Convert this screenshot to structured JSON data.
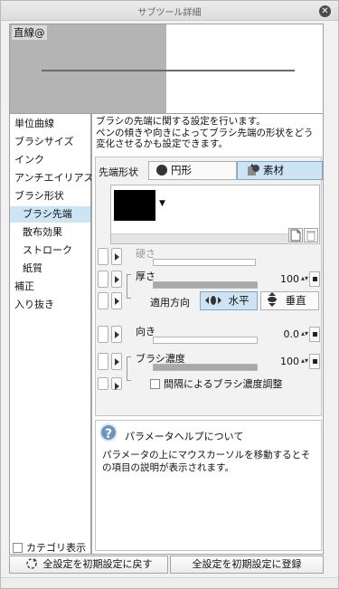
{
  "window": {
    "title": "サブツール詳細",
    "close_glyph": "✕"
  },
  "preview": {
    "label": "直線@"
  },
  "categories": [
    {
      "label": "単位曲線",
      "level": "top",
      "selected": false
    },
    {
      "label": "ブラシサイズ",
      "level": "top",
      "selected": false
    },
    {
      "label": "インク",
      "level": "top",
      "selected": false
    },
    {
      "label": "アンチエイリアス",
      "level": "top",
      "selected": false
    },
    {
      "label": "ブラシ形状",
      "level": "top",
      "selected": false
    },
    {
      "label": "ブラシ先端",
      "level": "sub",
      "selected": true
    },
    {
      "label": "散布効果",
      "level": "sub",
      "selected": false
    },
    {
      "label": "ストローク",
      "level": "sub",
      "selected": false
    },
    {
      "label": "紙質",
      "level": "sub",
      "selected": false
    },
    {
      "label": "補正",
      "level": "top",
      "selected": false
    },
    {
      "label": "入り抜き",
      "level": "top",
      "selected": false
    }
  ],
  "category_display_label": "カテゴリ表示",
  "description": "ブラシの先端に関する設定を行います。\nペンの傾きや向きによってブラシ先端の形状をどう変化させるかも設定できます。",
  "tip_shape": {
    "label": "先端形状",
    "options": [
      {
        "label": "円形",
        "icon": "circle-icon",
        "active": false
      },
      {
        "label": "素材",
        "icon": "material-icon",
        "active": true
      }
    ]
  },
  "params": {
    "hardness": {
      "label": "硬さ",
      "enabled": false
    },
    "thickness": {
      "label": "厚さ",
      "value": "100",
      "fraction": 1.0
    },
    "apply_direction": {
      "label": "適用方向",
      "options": [
        {
          "label": "水平",
          "icon": "horizontal-icon",
          "active": true
        },
        {
          "label": "垂直",
          "icon": "vertical-icon",
          "active": false
        }
      ]
    },
    "direction": {
      "label": "向き",
      "value": "0.0",
      "fraction": 0.0
    },
    "density": {
      "label": "ブラシ濃度",
      "value": "100",
      "fraction": 1.0
    },
    "interval_adjust": {
      "label": "間隔によるブラシ濃度調整",
      "checked": false
    }
  },
  "help": {
    "title": "パラメータヘルプについて",
    "body": "パラメータの上にマウスカーソルを移動するとその項目の説明が表示されます。"
  },
  "buttons": {
    "reset": "全設定を初期設定に戻す",
    "register": "全設定を初期設定に登録"
  },
  "colors": {
    "selection": "#cde4f5",
    "swatch": "#000000"
  }
}
